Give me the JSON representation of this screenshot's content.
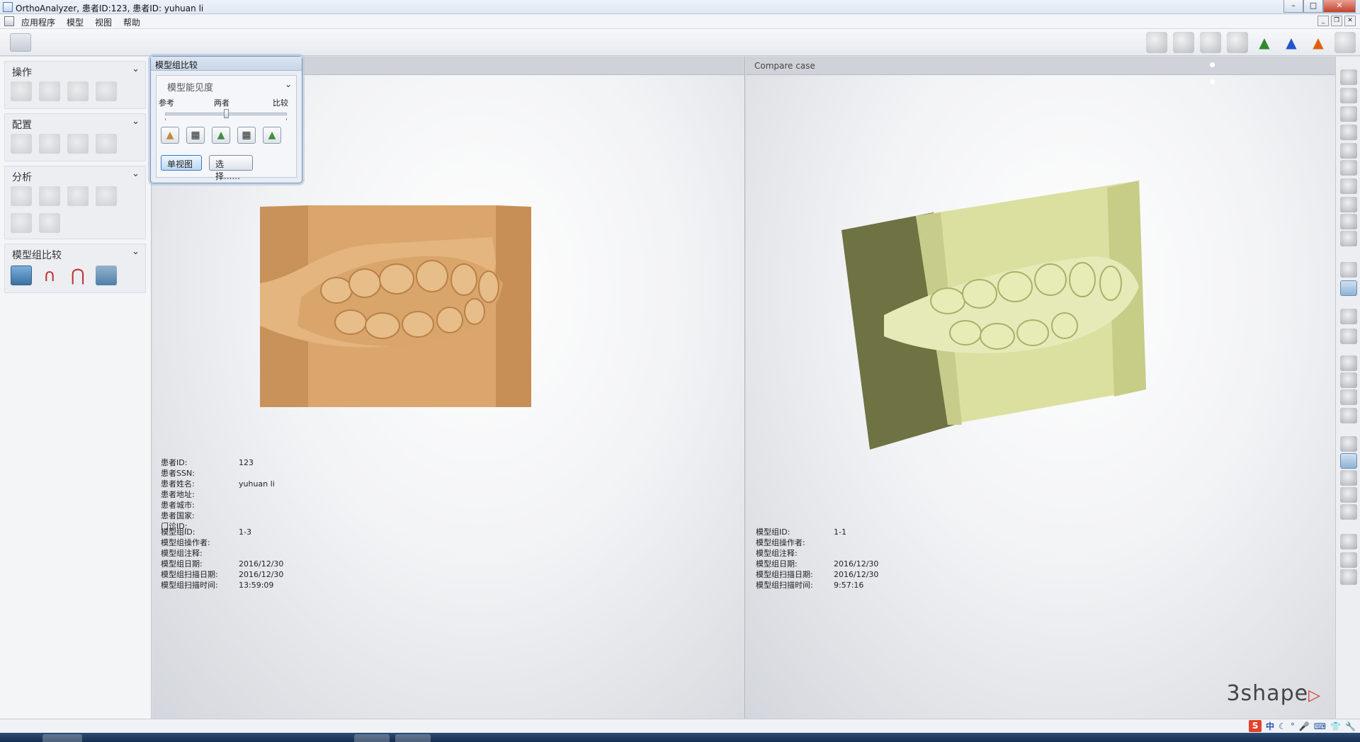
{
  "window": {
    "title": "OrthoAnalyzer, 患者ID:123, 患者ID: yuhuan li",
    "buttons": {
      "minimize": "–",
      "maximize": "□",
      "close": "✕"
    }
  },
  "menu": {
    "items": [
      "应用程序",
      "模型",
      "视图",
      "帮助"
    ]
  },
  "left_panel": {
    "sections": [
      {
        "title": "操作",
        "icons": [
          "operate-icon-1",
          "operate-icon-2",
          "operate-icon-3",
          "operate-icon-4"
        ]
      },
      {
        "title": "配置",
        "icons": [
          "axis-icon",
          "base-icon",
          "hourglass-icon",
          "tooth-figure-icon"
        ]
      },
      {
        "title": "分析",
        "icons": [
          "curve-icon",
          "ruler-icon",
          "angle-icon",
          "report-icon",
          "table-icon",
          "shield-icon"
        ]
      },
      {
        "title": "模型组比较",
        "icons": [
          "compare-view-icon",
          "magnet-icon",
          "magnet-red-icon",
          "overlay-icon"
        ]
      }
    ]
  },
  "dialog": {
    "title": "模型组比较",
    "visibility_dropdown": "模型能见度",
    "slider_labels": {
      "left": "参考",
      "middle": "两者",
      "right": "比较"
    },
    "slider_value": 0.5,
    "buttons": {
      "single_view": "单视图",
      "select": "选择......"
    }
  },
  "viewport_left": {
    "label": "",
    "patient": [
      {
        "key": "患者ID:",
        "value": "123"
      },
      {
        "key": "患者SSN:",
        "value": ""
      },
      {
        "key": "患者姓名:",
        "value": "yuhuan li"
      },
      {
        "key": "患者地址:",
        "value": ""
      },
      {
        "key": "患者城市:",
        "value": ""
      },
      {
        "key": "患者国家:",
        "value": ""
      },
      {
        "key": "门诊ID:",
        "value": ""
      }
    ],
    "model": [
      {
        "key": "模型组ID:",
        "value": "1-3"
      },
      {
        "key": "模型组操作者:",
        "value": ""
      },
      {
        "key": "模型组注释:",
        "value": ""
      },
      {
        "key": "模型组日期:",
        "value": "2016/12/30"
      },
      {
        "key": "模型组扫描日期:",
        "value": "2016/12/30"
      },
      {
        "key": "模型组扫描时间:",
        "value": "13:59:09"
      }
    ],
    "model_color": "#d9a56b"
  },
  "viewport_right": {
    "label": "Compare case",
    "model": [
      {
        "key": "模型组ID:",
        "value": "1-1"
      },
      {
        "key": "模型组操作者:",
        "value": ""
      },
      {
        "key": "模型组注释:",
        "value": ""
      },
      {
        "key": "模型组日期:",
        "value": "2016/12/30"
      },
      {
        "key": "模型组扫描日期:",
        "value": "2016/12/30"
      },
      {
        "key": "模型组扫描时间:",
        "value": "9:57:16"
      }
    ],
    "model_color": "#dbe0a0"
  },
  "brand": {
    "text": "3shape",
    "mark": "▷"
  },
  "statusbar": {
    "ime": [
      "S",
      "中",
      "☾",
      "°",
      "🎤",
      "⌨",
      "👕",
      "🔧"
    ]
  }
}
